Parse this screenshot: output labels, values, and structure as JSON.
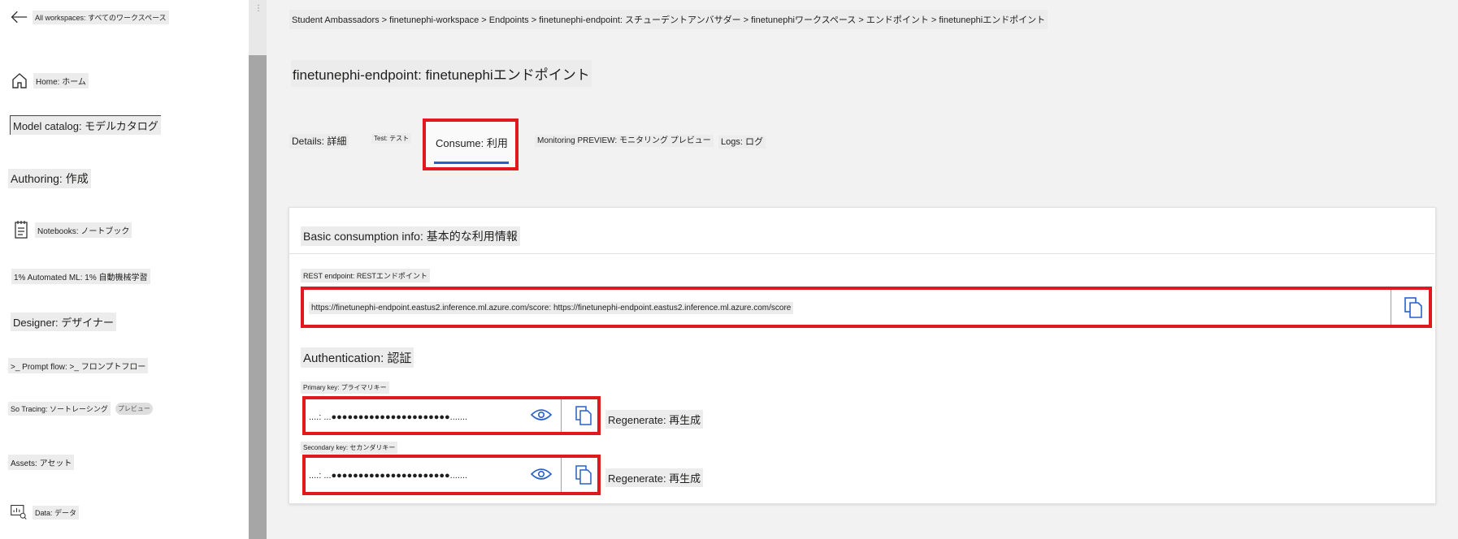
{
  "sidebar": {
    "all_workspaces": "All workspaces: すべてのワークスペース",
    "items": [
      {
        "label": "Home: ホーム",
        "icon": "home-icon"
      },
      {
        "label": "Model catalog: モデルカタログ",
        "icon": "catalog-icon"
      },
      {
        "label": "Authoring: 作成",
        "icon": ""
      },
      {
        "label": "Notebooks: ノートブック",
        "icon": "notebook-icon"
      },
      {
        "label": "1% Automated ML: 1% 自動機械学習",
        "icon": ""
      },
      {
        "label": "Designer: デザイナー",
        "icon": ""
      },
      {
        "label": ">_ Prompt flow: >_ フロンプトフロー",
        "icon": ""
      },
      {
        "label": "So Tracing: ソートレーシング",
        "icon": ""
      },
      {
        "label": "Assets: アセット",
        "icon": ""
      },
      {
        "label": "Data: データ",
        "icon": "data-icon"
      }
    ],
    "preview_badge": "プレビュー"
  },
  "breadcrumb": "Student Ambassadors > finetunephi-workspace > Endpoints > finetunephi-endpoint: スチューデントアンバサダー > finetunephiワークスペース > エンドポイント > finetunephiエンドポイント",
  "page_title": "finetunephi-endpoint: finetunephiエンドポイント",
  "tabs": [
    "Details: 詳細",
    "Test: テスト",
    "Consume: 利用",
    "Monitoring PREVIEW: モニタリング プレビュー",
    "Logs: ログ"
  ],
  "consume": {
    "section_title": "Basic consumption info: 基本的な利用情報",
    "rest_label": "REST endpoint: RESTエンドポイント",
    "rest_value": "https://finetunephi-endpoint.eastus2.inference.ml.azure.com/score: https://finetunephi-endpoint.eastus2.inference.ml.azure.com/score",
    "auth_title": "Authentication: 認証",
    "primary_label": "Primary key: プライマリキー",
    "primary_value": "....: ...●●●●●●●●●●●●●●●●●●●●●●.......",
    "secondary_label": "Secondary key: セカンダリキー",
    "secondary_value": "....: ...●●●●●●●●●●●●●●●●●●●●●●.......",
    "regenerate_label": "Regenerate: 再生成"
  },
  "colors": {
    "highlight": "#e0191f",
    "accent": "#2760c8"
  }
}
